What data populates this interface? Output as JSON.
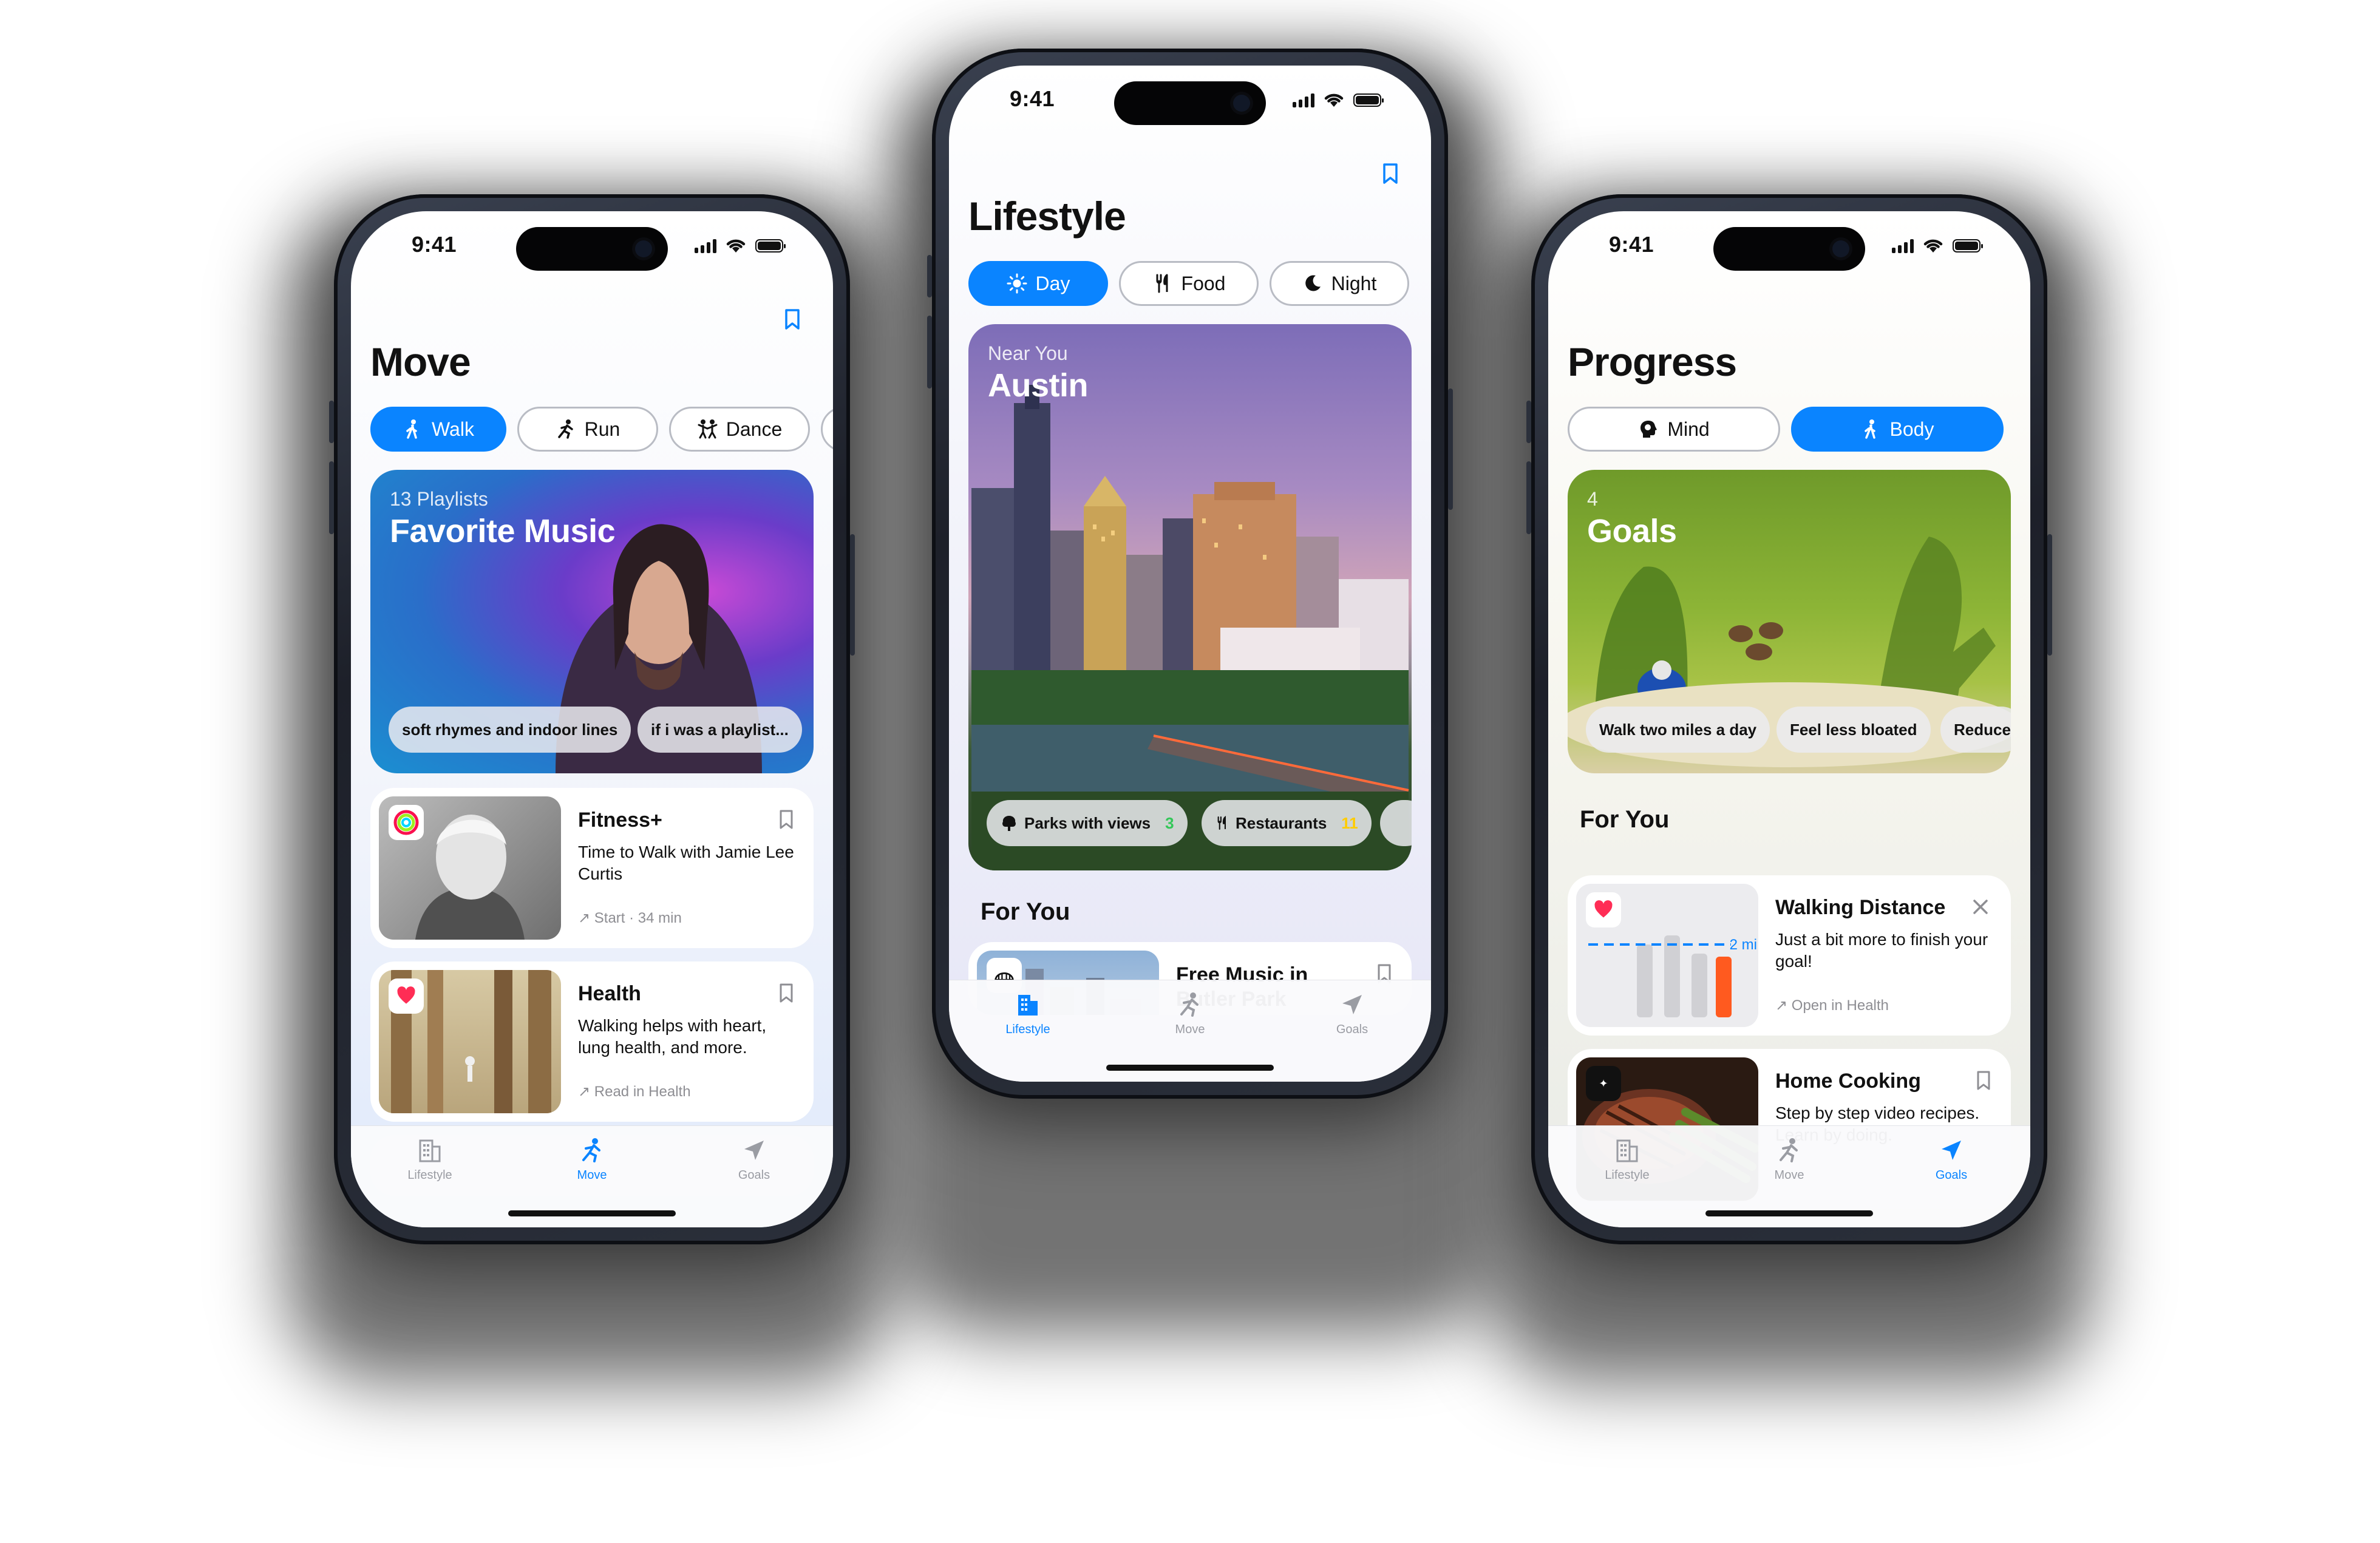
{
  "status": {
    "time": "9:41"
  },
  "tabs": {
    "lifestyle": "Lifestyle",
    "move": "Move",
    "goals": "Goals"
  },
  "move": {
    "title": "Move",
    "pills": [
      "Walk",
      "Run",
      "Dance"
    ],
    "hero": {
      "sub": "13 Playlists",
      "title": "Favorite Music",
      "chips": [
        "soft rhymes and indoor lines",
        "if i was a playlist..."
      ]
    },
    "cards": [
      {
        "title": "Fitness+",
        "subtitle": "Time to Walk with  Jamie Lee Curtis",
        "meta": "Start · 34 min"
      },
      {
        "title": "Health",
        "subtitle": "Walking helps with heart, lung health, and more.",
        "meta": "Read in Health"
      }
    ]
  },
  "lifestyle": {
    "title": "Lifestyle",
    "pills": [
      "Day",
      "Food",
      "Night"
    ],
    "hero": {
      "sub": "Near You",
      "title": "Austin",
      "chips": [
        {
          "label": "Parks with views",
          "count": "3"
        },
        {
          "label": "Restaurants",
          "count": "11"
        }
      ]
    },
    "section": "For You",
    "cards": [
      {
        "title": "Free Music in Butler Park"
      }
    ]
  },
  "progress": {
    "title": "Progress",
    "pills": [
      "Mind",
      "Body"
    ],
    "hero": {
      "sub": "4",
      "title": "Goals",
      "chips": [
        "Walk two miles a day",
        "Feel less bloated",
        "Reduce"
      ]
    },
    "section": "For You",
    "cards": [
      {
        "title": "Walking Distance",
        "subtitle": "Just a bit more to finish your goal!",
        "meta": "Open in Health",
        "goal_label": "2 mi"
      },
      {
        "title": "Home Cooking",
        "subtitle": "Step by step video recipes. Learn by doing."
      }
    ]
  },
  "colors": {
    "accent": "#0a84ff",
    "count_green": "#34c759",
    "count_yellow": "#ffcc00",
    "bar_orange": "#ff5a1f"
  }
}
